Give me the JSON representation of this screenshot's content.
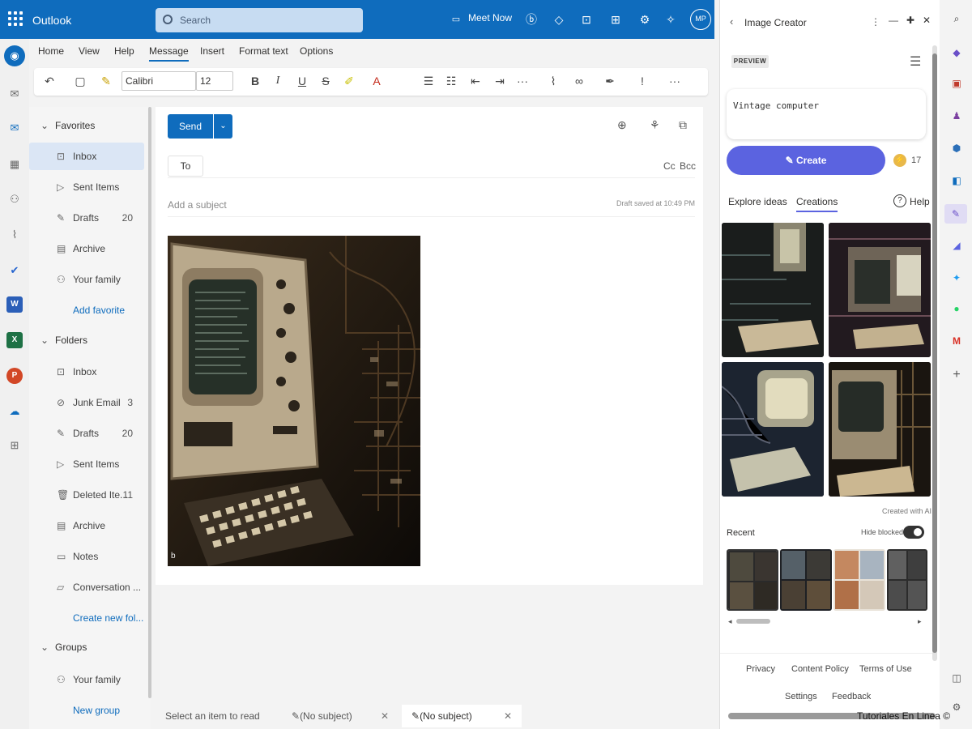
{
  "topbar": {
    "app_name": "Outlook",
    "search_placeholder": "Search",
    "meet_now": "Meet Now",
    "avatar_initials": "MP"
  },
  "ribbon": {
    "tabs": [
      "Home",
      "View",
      "Help",
      "Message",
      "Insert",
      "Format text",
      "Options"
    ],
    "active_tab": "Message",
    "font_name": "Calibri",
    "font_size": "12",
    "tools": [
      "undo-icon",
      "clipboard-icon",
      "format-painter-icon",
      "bold-icon",
      "italic-icon",
      "underline-icon",
      "strikethrough-icon",
      "highlight-icon",
      "font-color-icon",
      "bullets-icon",
      "numbering-icon",
      "decrease-indent-icon",
      "increase-indent-icon",
      "more-icon",
      "attach-icon",
      "link-icon",
      "signature-icon",
      "importance-icon",
      "more-icon"
    ],
    "labels": {
      "bold": "B",
      "italic": "I",
      "underline": "U",
      "strike": "S",
      "more": "···"
    }
  },
  "folders": {
    "favorites_header": "Favorites",
    "favorites": [
      {
        "label": "Inbox",
        "count": "",
        "icon": "inbox-icon"
      },
      {
        "label": "Sent Items",
        "count": "",
        "icon": "sent-icon"
      },
      {
        "label": "Drafts",
        "count": "20",
        "icon": "drafts-icon"
      },
      {
        "label": "Archive",
        "count": "",
        "icon": "archive-icon"
      },
      {
        "label": "Your family",
        "count": "",
        "icon": "group-icon"
      }
    ],
    "add_favorite": "Add favorite",
    "folders_header": "Folders",
    "folders": [
      {
        "label": "Inbox",
        "count": "",
        "icon": "inbox-icon"
      },
      {
        "label": "Junk Email",
        "count": "3",
        "icon": "junk-icon"
      },
      {
        "label": "Drafts",
        "count": "20",
        "icon": "drafts-icon"
      },
      {
        "label": "Sent Items",
        "count": "",
        "icon": "sent-icon"
      },
      {
        "label": "Deleted Ite...",
        "count": "11",
        "icon": "trash-icon"
      },
      {
        "label": "Archive",
        "count": "",
        "icon": "archive-icon"
      },
      {
        "label": "Notes",
        "count": "",
        "icon": "notes-icon"
      },
      {
        "label": "Conversation ...",
        "count": "",
        "icon": "folder-icon"
      }
    ],
    "create_folder": "Create new fol...",
    "groups_header": "Groups",
    "groups": [
      {
        "label": "Your family",
        "icon": "group-icon"
      }
    ],
    "new_group": "New group"
  },
  "compose": {
    "send_label": "Send",
    "to_label": "To",
    "cc_label": "Cc",
    "bcc_label": "Bcc",
    "subject_placeholder": "Add a subject",
    "draft_saved": "Draft saved at 10:49 PM",
    "image_caption": "b"
  },
  "bottom_tabs": [
    {
      "label": "Select an item to read",
      "active": false
    },
    {
      "label": "(No subject)",
      "active": false
    },
    {
      "label": "(No subject)",
      "active": true
    }
  ],
  "image_creator": {
    "title": "Image Creator",
    "preview_badge": "PREVIEW",
    "prompt": "Vintage computer",
    "create_label": "Create",
    "boosts": "17",
    "tabs": [
      "Explore ideas",
      "Creations"
    ],
    "active_tab": "Creations",
    "help_label": "Help",
    "created_note": "Created with AI",
    "recent_label": "Recent",
    "hide_blocked": "Hide blocked",
    "footer_links": [
      "Privacy",
      "Content Policy",
      "Terms of Use",
      "Settings",
      "Feedback"
    ]
  },
  "watermark": "Tutoriales En Linea ©",
  "colors": {
    "brand": "#0f6cbd",
    "create": "#5b63e0"
  }
}
